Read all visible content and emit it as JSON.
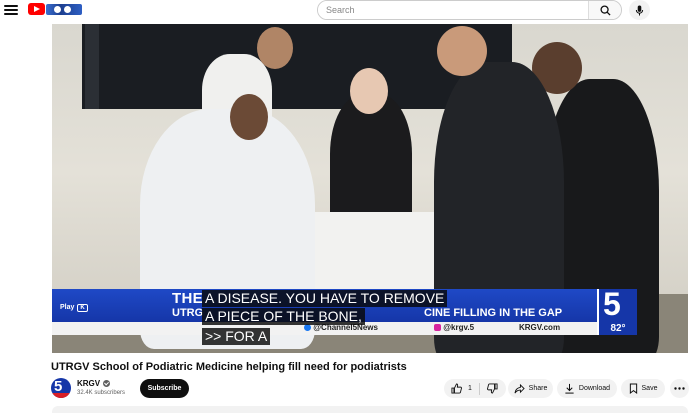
{
  "header": {
    "search_placeholder": "Search"
  },
  "player": {
    "lower_third": {
      "title": "THE",
      "subtitle": "UTRG",
      "subtitle_end": "CINE FILLING IN THE GAP",
      "play_label": "Play",
      "play_key": "K",
      "social_facebook": "@Channel5News",
      "social_instagram": "@krgv.5",
      "website": "KRGV.com",
      "station_number": "5",
      "temperature": "82°"
    },
    "captions": [
      "A DISEASE. YOU HAVE TO REMOVE",
      "A PIECE OF THE BONE,",
      ">> FOR A"
    ]
  },
  "video": {
    "title": "UTRGV School of Podiatric Medicine helping fill need for podiatrists"
  },
  "channel": {
    "name": "KRGV",
    "subscribers": "32.4K subscribers",
    "avatar_text": "5",
    "subscribe_label": "Subscribe"
  },
  "actions": {
    "like_count": "1",
    "share_label": "Share",
    "download_label": "Download",
    "save_label": "Save"
  },
  "colors": {
    "brand_red": "#ff0000",
    "news_blue": "#1536a8"
  }
}
